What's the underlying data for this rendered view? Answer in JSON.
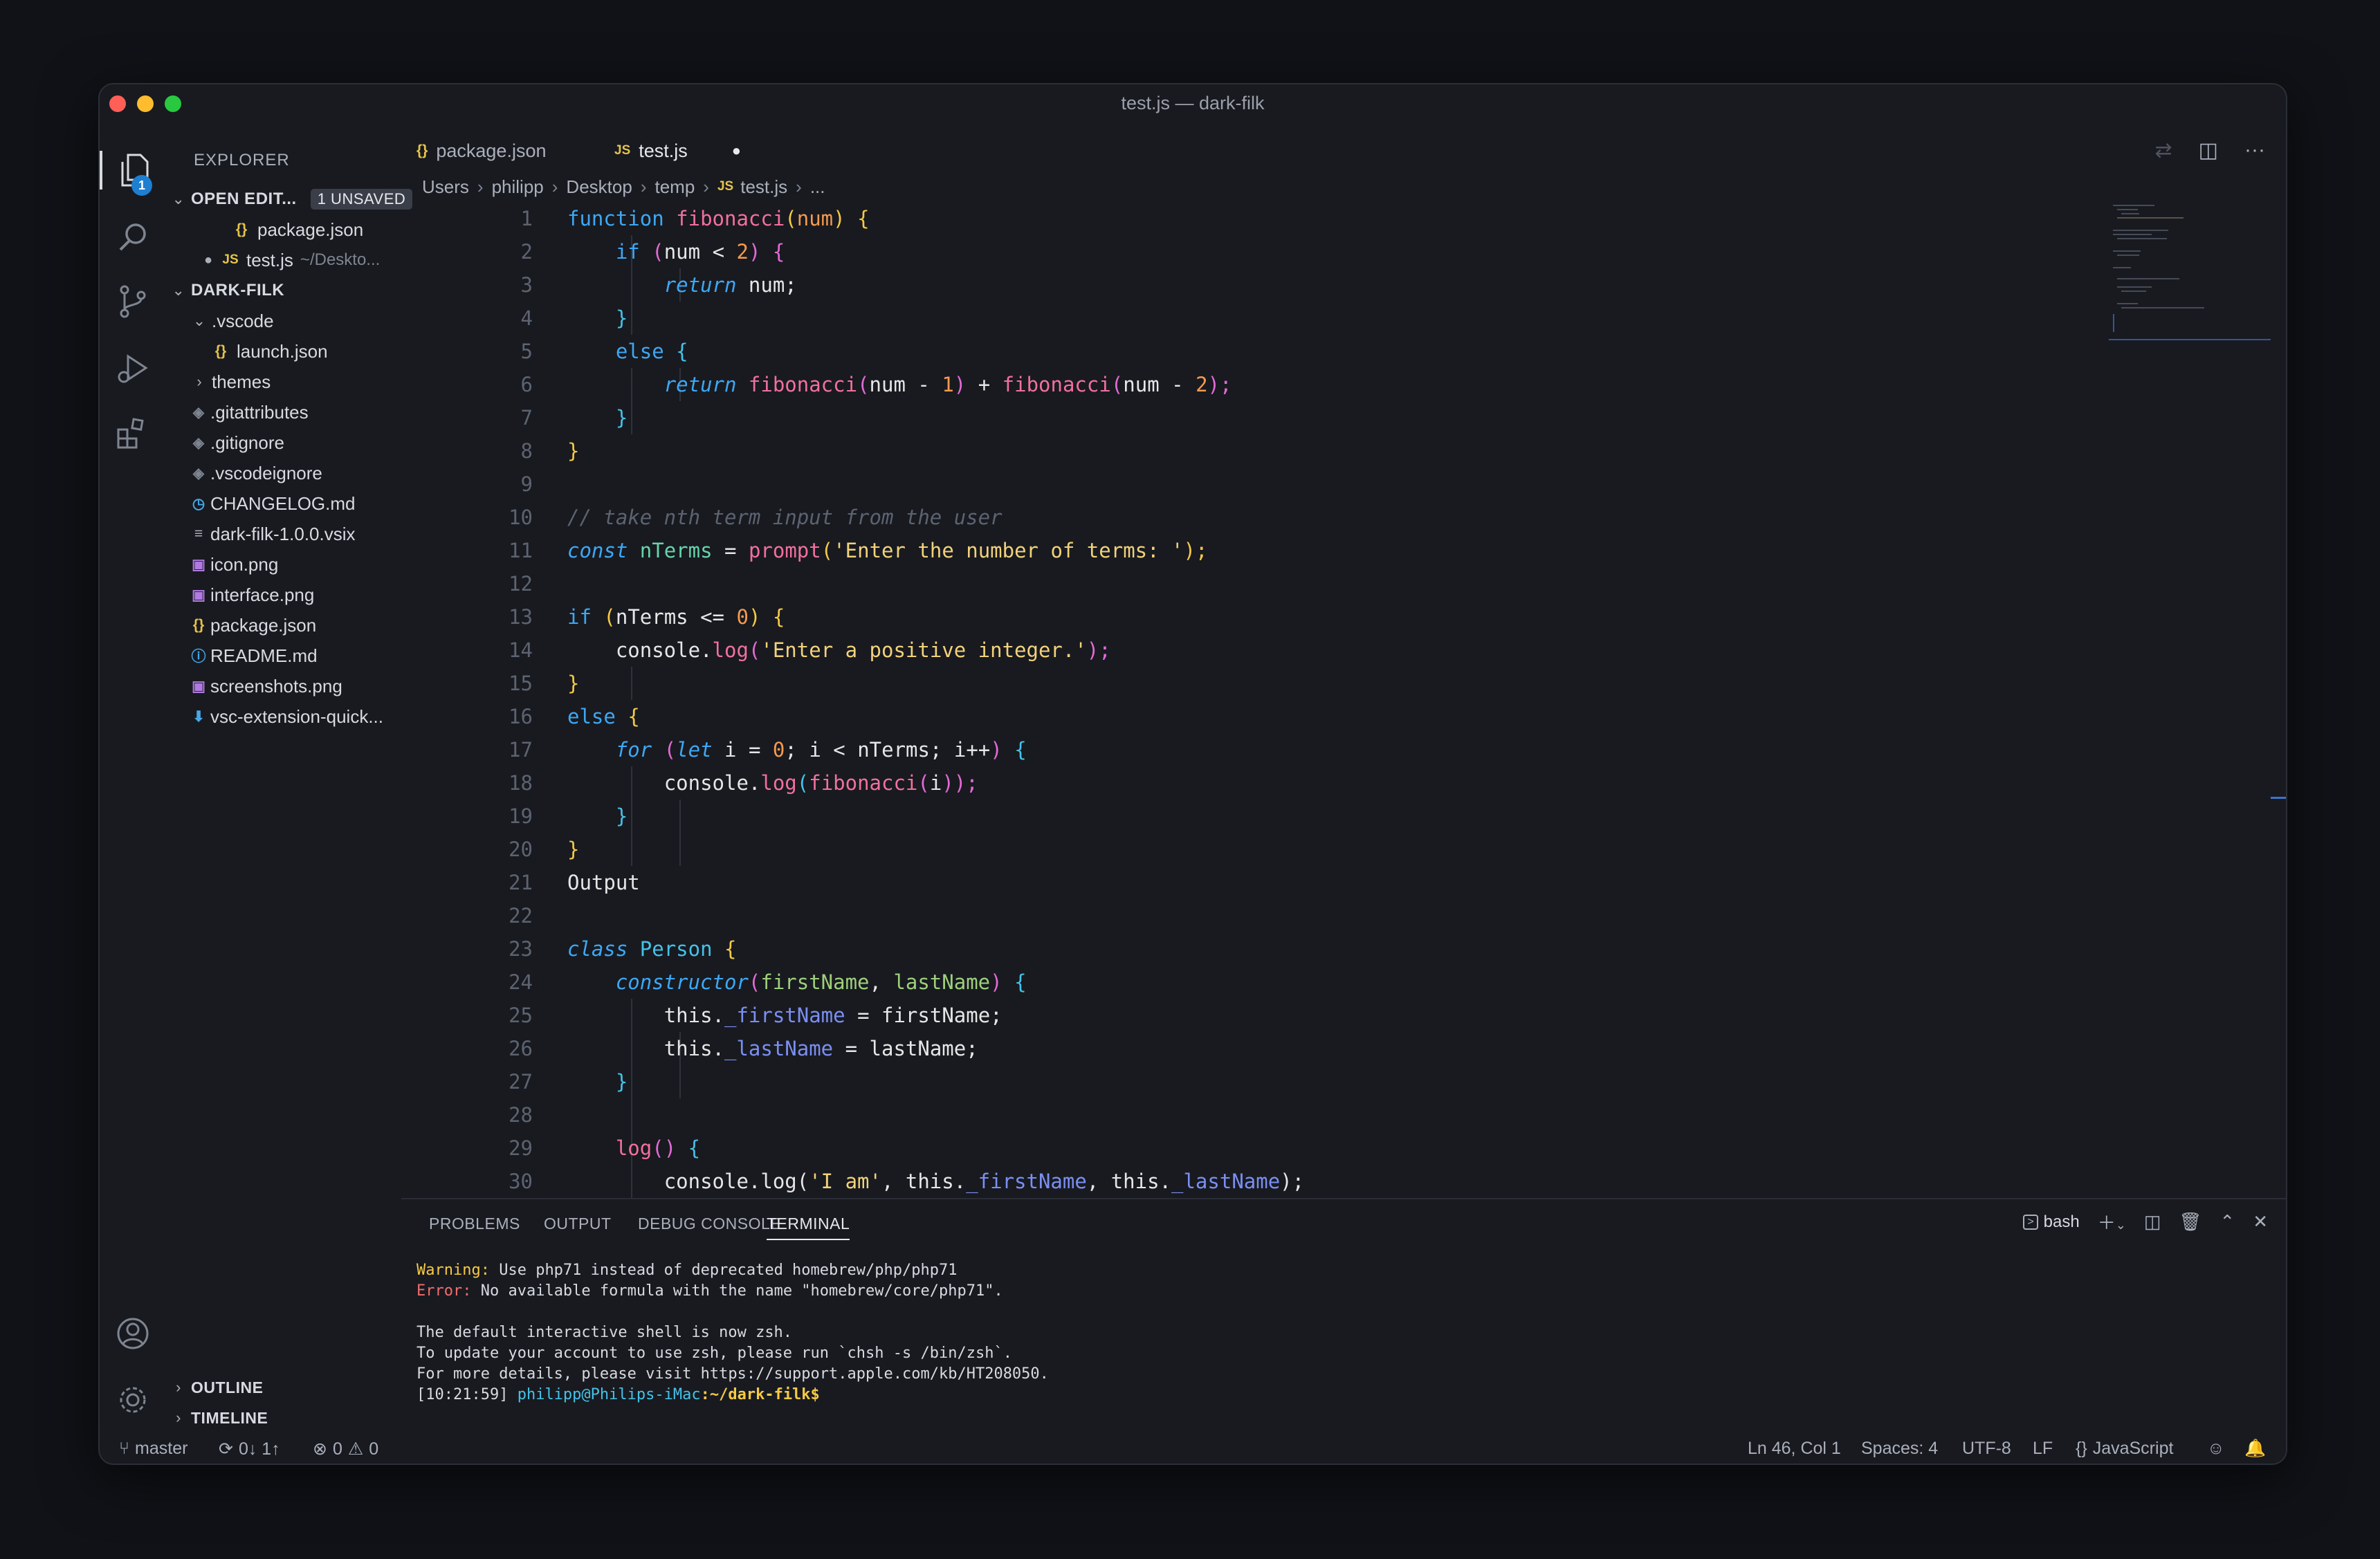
{
  "window": {
    "title": "test.js — dark-filk"
  },
  "explorer": {
    "header": "EXPLORER",
    "more": "···",
    "open_editors_label": "OPEN EDIT...",
    "unsaved_badge": "1 UNSAVED",
    "open_editors": [
      {
        "name": "package.json",
        "icon": "{}",
        "path": ""
      },
      {
        "name": "test.js",
        "icon": "JS",
        "path": "~/Deskto..."
      }
    ],
    "project_label": "DARK-FILK",
    "files": [
      ".vscode",
      "launch.json",
      "themes",
      ".gitattributes",
      ".gitignore",
      ".vscodeignore",
      "CHANGELOG.md",
      "dark-filk-1.0.0.vsix",
      "icon.png",
      "interface.png",
      "package.json",
      "README.md",
      "screenshots.png",
      "vsc-extension-quick..."
    ],
    "outline_label": "OUTLINE",
    "timeline_label": "TIMELINE"
  },
  "activity": {
    "badge": "1"
  },
  "tabs": [
    {
      "label": "package.json",
      "icon": "{}"
    },
    {
      "label": "test.js",
      "icon": "JS",
      "dirty": "●"
    }
  ],
  "breadcrumb": [
    "Users",
    "philipp",
    "Desktop",
    "temp",
    "test.js",
    "..."
  ],
  "editor": {
    "line_numbers": [
      "1",
      "2",
      "3",
      "4",
      "5",
      "6",
      "7",
      "8",
      "9",
      "10",
      "11",
      "12",
      "13",
      "14",
      "15",
      "16",
      "17",
      "18",
      "19",
      "20",
      "21",
      "22",
      "23",
      "24",
      "25",
      "26",
      "27",
      "28",
      "29",
      "30"
    ],
    "tokens": {
      "l1": [
        "function",
        "fibonacci",
        "(",
        "num",
        ")",
        "{"
      ],
      "l2": [
        "if",
        "(",
        "num",
        "<",
        "2",
        ")",
        "{"
      ],
      "l3": [
        "return",
        "num;"
      ],
      "l4": [
        "}"
      ],
      "l5": [
        "else",
        "{"
      ],
      "l6": [
        "return",
        "fibonacci",
        "(",
        "num",
        "-",
        "1",
        ")",
        "+",
        "fibonacci",
        "(",
        "num",
        "-",
        "2",
        ");"
      ],
      "l7": [
        "}"
      ],
      "l8": [
        "}"
      ],
      "l10": [
        "// take nth term input from the user"
      ],
      "l11": [
        "const",
        "nTerms",
        "=",
        "prompt",
        "(",
        "'Enter the number of terms: '",
        ");"
      ],
      "l13": [
        "if",
        "(",
        "nTerms",
        "<=",
        "0",
        ")",
        "{"
      ],
      "l14": [
        "console.",
        "log",
        "(",
        "'Enter a positive integer.'",
        ");"
      ],
      "l15": [
        "}"
      ],
      "l16": [
        "else",
        "{"
      ],
      "l17": [
        "for",
        "(",
        "let",
        "i",
        "=",
        "0",
        ";",
        "i",
        "<",
        "nTerms;",
        "i++",
        ")",
        "{"
      ],
      "l18": [
        "console.",
        "log",
        "(",
        "fibonacci",
        "(",
        "i",
        "));"
      ],
      "l19": [
        "}"
      ],
      "l20": [
        "}"
      ],
      "l21": [
        "Output"
      ],
      "l23": [
        "class",
        "Person",
        "{"
      ],
      "l24": [
        "constructor",
        "(",
        "firstName",
        ",",
        "lastName",
        ")",
        "{"
      ],
      "l25": [
        "this.",
        "_firstName",
        "=",
        "firstName;"
      ],
      "l26": [
        "this.",
        "_lastName",
        "=",
        "lastName;"
      ],
      "l27": [
        "}"
      ],
      "l29": [
        "log",
        "()",
        "{"
      ],
      "l30": [
        "console.log(",
        "'I am'",
        ", this.",
        "_firstName",
        ", this.",
        "_lastName",
        ");"
      ]
    }
  },
  "panel": {
    "tabs": [
      "PROBLEMS",
      "OUTPUT",
      "DEBUG CONSOLE",
      "TERMINAL"
    ],
    "shell": "bash",
    "terminal": {
      "warning_label": "Warning:",
      "warning_text": " Use php71 instead of deprecated homebrew/php/php71",
      "error_label": "Error:",
      "error_text": " No available formula with the name \"homebrew/core/php71\".",
      "line3": "The default interactive shell is now zsh.",
      "line4": "To update your account to use zsh, please run `chsh -s /bin/zsh`.",
      "line5": "For more details, please visit https://support.apple.com/kb/HT208050.",
      "prompt_time": "[10:21:59]",
      "prompt_user": "philipp@Philips-iMac",
      "prompt_path": ":~/dark-filk$"
    }
  },
  "statusbar": {
    "branch": "master",
    "sync": "0↓ 1↑",
    "errors": "0",
    "warnings": "0",
    "position": "Ln 46, Col 1",
    "spaces": "Spaces: 4",
    "encoding": "UTF-8",
    "eol": "LF",
    "language": "JavaScript"
  },
  "colors": {
    "accent": "#1e7fd1",
    "background": "#181a20"
  }
}
